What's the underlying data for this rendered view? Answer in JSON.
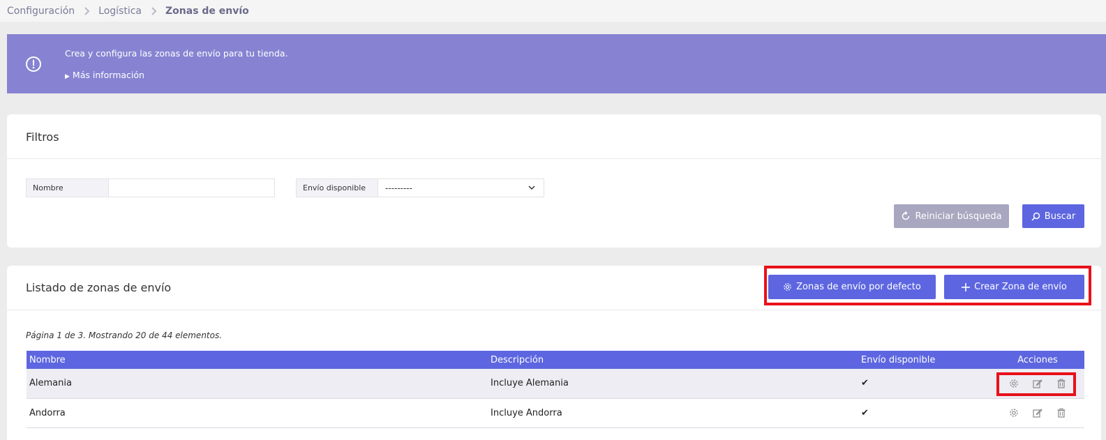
{
  "breadcrumb": [
    "Configuración",
    "Logística",
    "Zonas de envío"
  ],
  "info": {
    "text": "Crea y configura las zonas de envío para tu tienda.",
    "more": "Más información"
  },
  "filters": {
    "title": "Filtros",
    "name_label": "Nombre",
    "name_value": "",
    "shipping_label": "Envío disponible",
    "shipping_value": "---------",
    "reset_label": "Reiniciar búsqueda",
    "search_label": "Buscar"
  },
  "listing": {
    "title": "Listado de zonas de envío",
    "default_zones_label": "Zonas de envío por defecto",
    "create_label": "Crear Zona de envío",
    "pagination": "Página 1 de 3. Mostrando 20 de 44 elementos.",
    "columns": [
      "Nombre",
      "Descripción",
      "Envío disponible",
      "Acciones"
    ],
    "rows": [
      {
        "name": "Alemania",
        "description": "Incluye Alemania",
        "available": "✔"
      },
      {
        "name": "Andorra",
        "description": "Incluye Andorra",
        "available": "✔"
      }
    ]
  },
  "colors": {
    "banner": "#8783d2",
    "primary": "#5d66e0",
    "secondary": "#a7a7c0",
    "highlight": "#e8111b"
  }
}
